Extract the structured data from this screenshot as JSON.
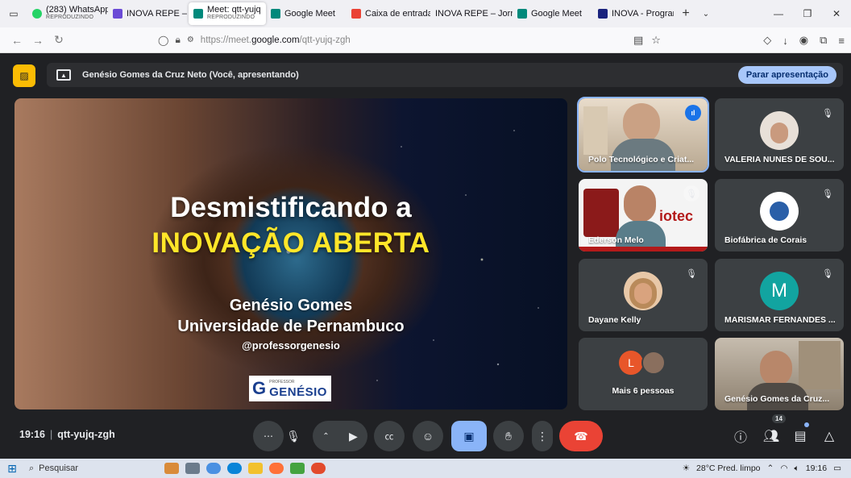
{
  "browser": {
    "tabs": [
      {
        "title": "(283) WhatsApp",
        "subtitle": "REPRODUZINDO",
        "color": "#25d366"
      },
      {
        "title": "INOVA REPE – Jo",
        "subtitle": "",
        "color": "#6b4bd6"
      },
      {
        "title": "Meet: qtt-yujq",
        "subtitle": "REPRODUZINDO",
        "color": "#00897b",
        "active": true
      },
      {
        "title": "Google Meet",
        "subtitle": "",
        "color": "#00897b"
      },
      {
        "title": "Caixa de entrada",
        "subtitle": "",
        "color": "#ea4335"
      },
      {
        "title": "INOVA REPE – Jornad",
        "subtitle": "",
        "color": ""
      },
      {
        "title": "Google Meet",
        "subtitle": "",
        "color": "#00897b"
      },
      {
        "title": "INOVA - Program",
        "subtitle": "",
        "color": "#1a237e"
      }
    ],
    "new_tab": "+",
    "url_prefix": "https://meet.",
    "url_domain": "google.com",
    "url_path": "/qtt-yujq-zgh"
  },
  "presenting": {
    "text": "Genésio Gomes da Cruz Neto (Você, apresentando)",
    "stop_label": "Parar apresentação"
  },
  "slide": {
    "title_line1": "Desmistificando a",
    "title_line2": "INOVAÇÃO ABERTA",
    "name": "Genésio Gomes",
    "university": "Universidade de Pernambuco",
    "handle": "@professorgenesio",
    "logo_small": "PROFESSOR",
    "logo_big": "GENÉSIO",
    "logo_letter": "G"
  },
  "participants": {
    "polo": "Polo Tecnológico e Criat...",
    "valeria": "VALERIA NUNES DE SOU...",
    "ederson": "Ederson Melo",
    "ederson_banner": "iotec",
    "biofabrica": "Biofábrica de Corais",
    "dayane": "Dayane Kelly",
    "marismar": "MARISMAR FERNANDES ...",
    "marismar_initial": "M",
    "more": "Mais 6 pessoas",
    "more_initial": "L",
    "genesio": "Genésio Gomes da Cruz..."
  },
  "controls": {
    "time": "19:16",
    "meeting_code": "qtt-yujq-zgh",
    "people_count": "14"
  },
  "taskbar": {
    "search_placeholder": "Pesquisar",
    "weather": "28°C  Pred. limpo",
    "clock": "19:16"
  }
}
